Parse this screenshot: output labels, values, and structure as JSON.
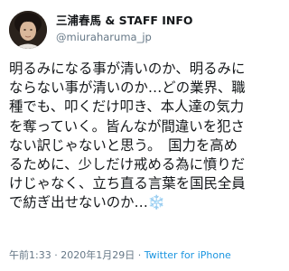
{
  "author": {
    "display_name": "三浦春馬 & STAFF INFO",
    "handle": "@miuraharuma_jp"
  },
  "tweet": {
    "text": "明るみになる事が清いのか、明るみにならない事が清いのか…どの業界、職種でも、叩くだけ叩き、本人達の気力を奪っていく。皆んなが間違いを犯さない訳じゃないと思う。　国力を高めるために、少しだけ戒める為に憤りだけじゃなく、立ち直る言葉を国民全員で紡ぎ出せないのか…❄️"
  },
  "meta": {
    "time": "午前1:33",
    "separator": " · ",
    "date": "2020年1月29日",
    "separator2": " · ",
    "source": "Twitter for iPhone"
  }
}
